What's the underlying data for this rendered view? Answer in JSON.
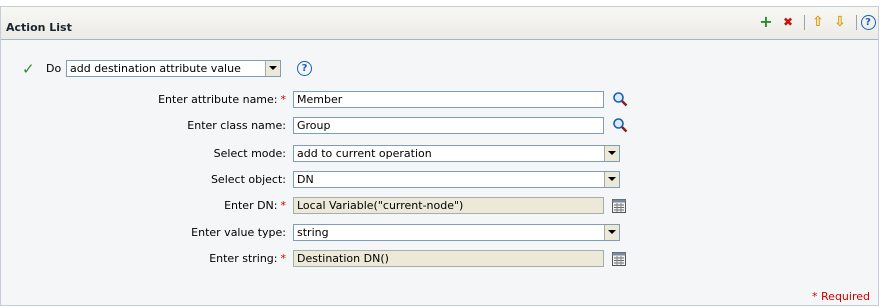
{
  "panel": {
    "title": "Action List",
    "toolbar": [
      {
        "name": "add-icon",
        "glyph": "+",
        "color": "#2e8b2e"
      },
      {
        "name": "delete-icon",
        "glyph": "✖",
        "color": "#cc1111"
      },
      {
        "name": "move-up-icon",
        "glyph": "⇧",
        "color": "#d79a00"
      },
      {
        "name": "move-down-icon",
        "glyph": "⇩",
        "color": "#d79a00"
      },
      {
        "name": "help-icon",
        "glyph": "?",
        "color": "#1a5fb4"
      }
    ]
  },
  "action": {
    "do_label": "Do",
    "do_value": "add destination attribute value",
    "check_glyph": "✓"
  },
  "fields": {
    "attribute_name": {
      "label": "Enter attribute name:",
      "value": "Member",
      "required": "*"
    },
    "class_name": {
      "label": "Enter class name:",
      "value": "Group"
    },
    "mode": {
      "label": "Select mode:",
      "value": "add to current operation"
    },
    "object": {
      "label": "Select object:",
      "value": "DN"
    },
    "dn": {
      "label": "Enter DN:",
      "value": "Local Variable(\"current-node\")",
      "required": "*"
    },
    "value_type": {
      "label": "Enter value type:",
      "value": "string"
    },
    "string": {
      "label": "Enter string:",
      "value": "Destination DN()",
      "required": "*"
    }
  },
  "footer": {
    "required_note": "* Required"
  }
}
